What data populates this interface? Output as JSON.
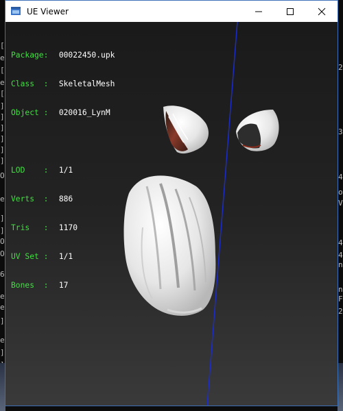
{
  "window": {
    "title": "UE Viewer"
  },
  "info_panel": {
    "object_rows": [
      {
        "label": "Package:",
        "value": "00022450.upk"
      },
      {
        "label": "Class  :",
        "value": "SkeletalMesh"
      },
      {
        "label": "Object :",
        "value": "020016_LynM"
      }
    ],
    "mesh_rows": [
      {
        "label": "LOD    :",
        "value": "1/1"
      },
      {
        "label": "Verts  :",
        "value": "886"
      },
      {
        "label": "Tris   :",
        "value": "1170"
      },
      {
        "label": "UV Set :",
        "value": "1/1"
      },
      {
        "label": "Bones  :",
        "value": "17"
      }
    ]
  },
  "background_console": {
    "left_chars": [
      "[",
      "e",
      "[",
      "e",
      "[",
      "]",
      "]",
      "]",
      "]",
      "]",
      "]",
      "O",
      "e",
      "]",
      "]",
      "O",
      "O",
      "6",
      "e",
      "e",
      "]",
      "e",
      "]",
      "]"
    ],
    "right_chars": [
      "2",
      "3",
      "4",
      "o",
      "V",
      "4",
      "4",
      "n",
      "n",
      "F",
      "2"
    ]
  },
  "colors": {
    "info_label": "#3fe23f",
    "info_value": "#ffffff",
    "axis_line": "#1c2cc8",
    "viewport_bg": "#1d1d1d",
    "title_bar": "#ffffff"
  }
}
